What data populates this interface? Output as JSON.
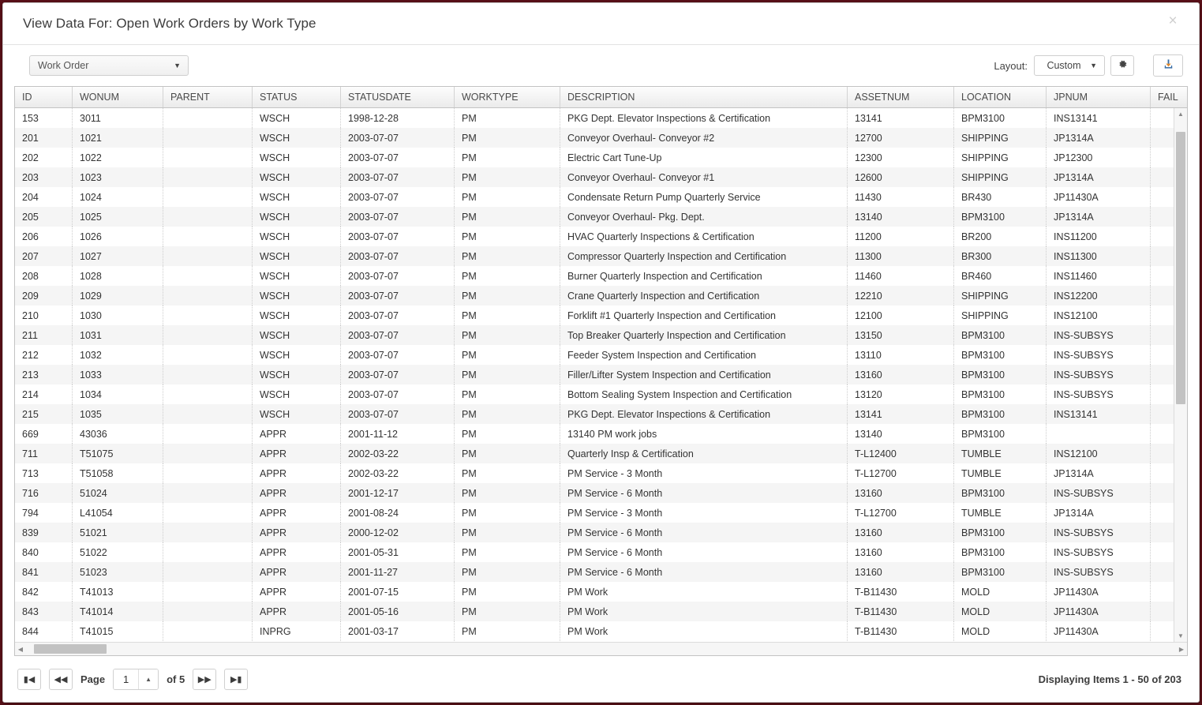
{
  "dialog": {
    "title": "View Data For: Open Work Orders by Work Type",
    "close_label": "×"
  },
  "toolbar": {
    "object_select": {
      "value": "Work Order",
      "caret": "▼"
    },
    "layout_label": "Layout:",
    "layout_select": {
      "value": "Custom",
      "caret": "▼"
    },
    "settings_icon": "gear-icon",
    "export_icon": "download-icon"
  },
  "grid": {
    "columns": [
      {
        "key": "id",
        "label": "ID"
      },
      {
        "key": "wonum",
        "label": "WONUM"
      },
      {
        "key": "parent",
        "label": "PARENT"
      },
      {
        "key": "status",
        "label": "STATUS"
      },
      {
        "key": "statusdate",
        "label": "STATUSDATE"
      },
      {
        "key": "worktype",
        "label": "WORKTYPE"
      },
      {
        "key": "description",
        "label": "DESCRIPTION"
      },
      {
        "key": "assetnum",
        "label": "ASSETNUM"
      },
      {
        "key": "location",
        "label": "LOCATION"
      },
      {
        "key": "jpnum",
        "label": "JPNUM"
      },
      {
        "key": "failurecode",
        "label": "FAIL"
      }
    ],
    "rows": [
      [
        "153",
        "3011",
        "",
        "WSCH",
        "1998-12-28",
        "PM",
        "PKG Dept. Elevator Inspections & Certification",
        "13141",
        "BPM3100",
        "INS13141",
        ""
      ],
      [
        "201",
        "1021",
        "",
        "WSCH",
        "2003-07-07",
        "PM",
        "Conveyor Overhaul- Conveyor #2",
        "12700",
        "SHIPPING",
        "JP1314A",
        ""
      ],
      [
        "202",
        "1022",
        "",
        "WSCH",
        "2003-07-07",
        "PM",
        "Electric Cart Tune-Up",
        "12300",
        "SHIPPING",
        "JP12300",
        ""
      ],
      [
        "203",
        "1023",
        "",
        "WSCH",
        "2003-07-07",
        "PM",
        "Conveyor Overhaul- Conveyor #1",
        "12600",
        "SHIPPING",
        "JP1314A",
        ""
      ],
      [
        "204",
        "1024",
        "",
        "WSCH",
        "2003-07-07",
        "PM",
        "Condensate Return Pump Quarterly Service",
        "11430",
        "BR430",
        "JP11430A",
        ""
      ],
      [
        "205",
        "1025",
        "",
        "WSCH",
        "2003-07-07",
        "PM",
        "Conveyor Overhaul- Pkg. Dept.",
        "13140",
        "BPM3100",
        "JP1314A",
        ""
      ],
      [
        "206",
        "1026",
        "",
        "WSCH",
        "2003-07-07",
        "PM",
        "HVAC Quarterly Inspections & Certification",
        "11200",
        "BR200",
        "INS11200",
        ""
      ],
      [
        "207",
        "1027",
        "",
        "WSCH",
        "2003-07-07",
        "PM",
        "Compressor Quarterly Inspection and Certification",
        "11300",
        "BR300",
        "INS11300",
        ""
      ],
      [
        "208",
        "1028",
        "",
        "WSCH",
        "2003-07-07",
        "PM",
        "Burner Quarterly Inspection and Certification",
        "11460",
        "BR460",
        "INS11460",
        ""
      ],
      [
        "209",
        "1029",
        "",
        "WSCH",
        "2003-07-07",
        "PM",
        "Crane Quarterly Inspection and Certification",
        "12210",
        "SHIPPING",
        "INS12200",
        ""
      ],
      [
        "210",
        "1030",
        "",
        "WSCH",
        "2003-07-07",
        "PM",
        "Forklift #1 Quarterly Inspection and Certification",
        "12100",
        "SHIPPING",
        "INS12100",
        ""
      ],
      [
        "211",
        "1031",
        "",
        "WSCH",
        "2003-07-07",
        "PM",
        "Top Breaker Quarterly Inspection and Certification",
        "13150",
        "BPM3100",
        "INS-SUBSYS",
        ""
      ],
      [
        "212",
        "1032",
        "",
        "WSCH",
        "2003-07-07",
        "PM",
        "Feeder System Inspection and Certification",
        "13110",
        "BPM3100",
        "INS-SUBSYS",
        ""
      ],
      [
        "213",
        "1033",
        "",
        "WSCH",
        "2003-07-07",
        "PM",
        "Filler/Lifter System Inspection and Certification",
        "13160",
        "BPM3100",
        "INS-SUBSYS",
        ""
      ],
      [
        "214",
        "1034",
        "",
        "WSCH",
        "2003-07-07",
        "PM",
        "Bottom Sealing System Inspection and Certification",
        "13120",
        "BPM3100",
        "INS-SUBSYS",
        ""
      ],
      [
        "215",
        "1035",
        "",
        "WSCH",
        "2003-07-07",
        "PM",
        "PKG Dept. Elevator Inspections & Certification",
        "13141",
        "BPM3100",
        "INS13141",
        ""
      ],
      [
        "669",
        "43036",
        "",
        "APPR",
        "2001-11-12",
        "PM",
        "13140 PM work jobs",
        "13140",
        "BPM3100",
        "",
        ""
      ],
      [
        "711",
        "T51075",
        "",
        "APPR",
        "2002-03-22",
        "PM",
        "Quarterly Insp & Certification",
        "T-L12400",
        "TUMBLE",
        "INS12100",
        ""
      ],
      [
        "713",
        "T51058",
        "",
        "APPR",
        "2002-03-22",
        "PM",
        "PM Service - 3 Month",
        "T-L12700",
        "TUMBLE",
        "JP1314A",
        ""
      ],
      [
        "716",
        "51024",
        "",
        "APPR",
        "2001-12-17",
        "PM",
        "PM Service - 6 Month",
        "13160",
        "BPM3100",
        "INS-SUBSYS",
        ""
      ],
      [
        "794",
        "L41054",
        "",
        "APPR",
        "2001-08-24",
        "PM",
        "PM Service - 3 Month",
        "T-L12700",
        "TUMBLE",
        "JP1314A",
        ""
      ],
      [
        "839",
        "51021",
        "",
        "APPR",
        "2000-12-02",
        "PM",
        "PM Service - 6 Month",
        "13160",
        "BPM3100",
        "INS-SUBSYS",
        ""
      ],
      [
        "840",
        "51022",
        "",
        "APPR",
        "2001-05-31",
        "PM",
        "PM Service - 6 Month",
        "13160",
        "BPM3100",
        "INS-SUBSYS",
        ""
      ],
      [
        "841",
        "51023",
        "",
        "APPR",
        "2001-11-27",
        "PM",
        "PM Service - 6 Month",
        "13160",
        "BPM3100",
        "INS-SUBSYS",
        ""
      ],
      [
        "842",
        "T41013",
        "",
        "APPR",
        "2001-07-15",
        "PM",
        "PM Work",
        "T-B11430",
        "MOLD",
        "JP11430A",
        ""
      ],
      [
        "843",
        "T41014",
        "",
        "APPR",
        "2001-05-16",
        "PM",
        "PM Work",
        "T-B11430",
        "MOLD",
        "JP11430A",
        ""
      ],
      [
        "844",
        "T41015",
        "",
        "INPRG",
        "2001-03-17",
        "PM",
        "PM Work",
        "T-B11430",
        "MOLD",
        "JP11430A",
        ""
      ]
    ]
  },
  "footer": {
    "first_label": "⏮",
    "prev_label": "⏪",
    "page_label": "Page",
    "page_value": "1",
    "spin_label": "▲",
    "of_label": "of 5",
    "next_label": "⏩",
    "last_label": "⏭",
    "status": "Displaying Items 1 - 50 of 203"
  }
}
